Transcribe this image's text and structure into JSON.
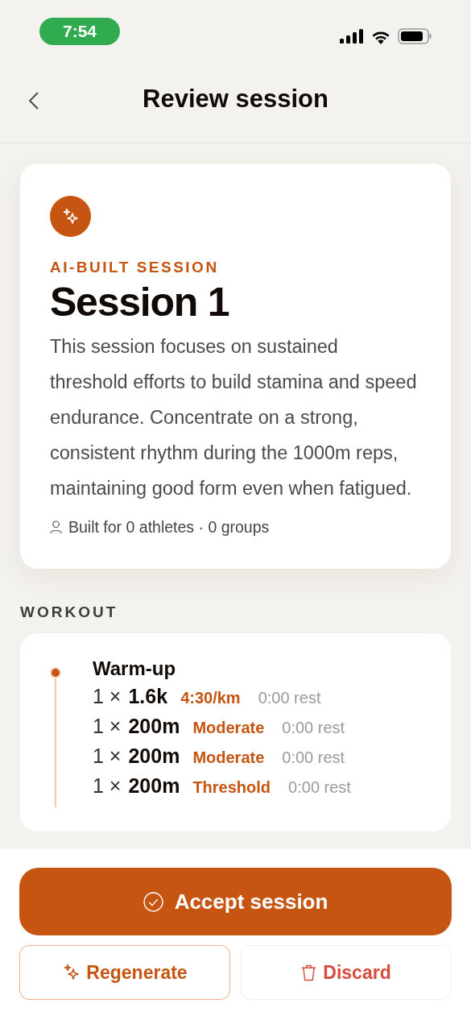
{
  "status_bar": {
    "time": "7:54"
  },
  "header": {
    "title": "Review session"
  },
  "summary": {
    "eyebrow": "AI-BUILT SESSION",
    "title": "Session 1",
    "description": "This session focuses on sustained threshold efforts to build stamina and speed endurance. Concentrate on a strong, consistent rhythm during the 1000m reps, maintaining good form even when fatigued.",
    "built_for": "Built for 0 athletes · 0 groups"
  },
  "workout": {
    "label": "WORKOUT",
    "blocks": [
      {
        "name": "Warm-up",
        "sets": [
          {
            "count": "1 ×",
            "distance": "1.6k",
            "target": "4:30/km",
            "rest": "0:00 rest"
          },
          {
            "count": "1 ×",
            "distance": "200m",
            "target": "Moderate",
            "rest": "0:00 rest"
          },
          {
            "count": "1 ×",
            "distance": "200m",
            "target": "Moderate",
            "rest": "0:00 rest"
          },
          {
            "count": "1 ×",
            "distance": "200m",
            "target": "Threshold",
            "rest": "0:00 rest"
          }
        ]
      }
    ]
  },
  "actions": {
    "accept": "Accept session",
    "regenerate": "Regenerate",
    "discard": "Discard"
  }
}
